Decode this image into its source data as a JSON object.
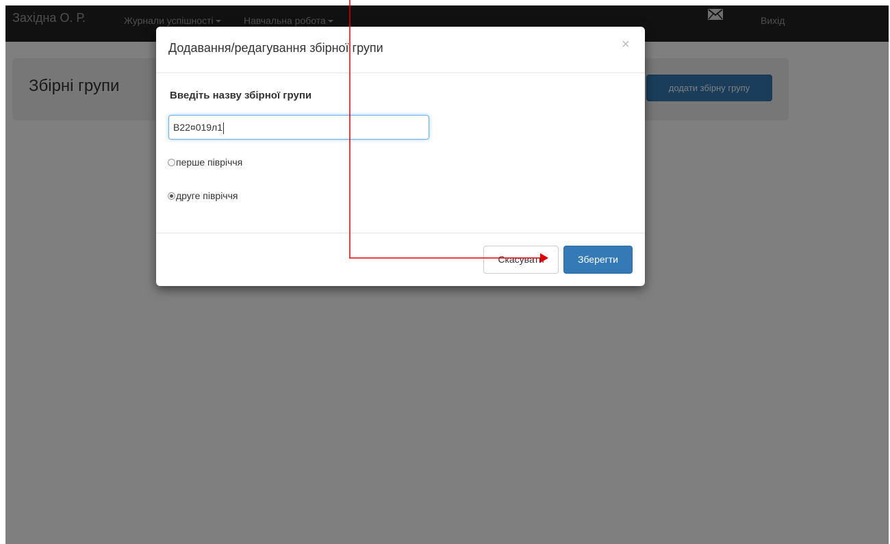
{
  "navbar": {
    "brand": "Західна О. Р.",
    "menu_journals": "Журнали успішності",
    "menu_study": "Навчальна робота",
    "mail_icon": "envelope-icon",
    "logout": "Вихід"
  },
  "page": {
    "title": "Збірні групи",
    "add_button": "додати збірну групу"
  },
  "modal": {
    "title": "Додавання/редагування збірної групи",
    "close": "×",
    "field_label": "Введіть назву збірної групи",
    "name_value": "В22¤019л1",
    "radio_first": "перше півріччя",
    "radio_second": "друге півріччя",
    "selected": "друге півріччя",
    "cancel": "Скасувати",
    "save": "Зберегти"
  },
  "colors": {
    "navbar": "#222222",
    "primary": "#337ab7",
    "annotation": "#e00000"
  }
}
